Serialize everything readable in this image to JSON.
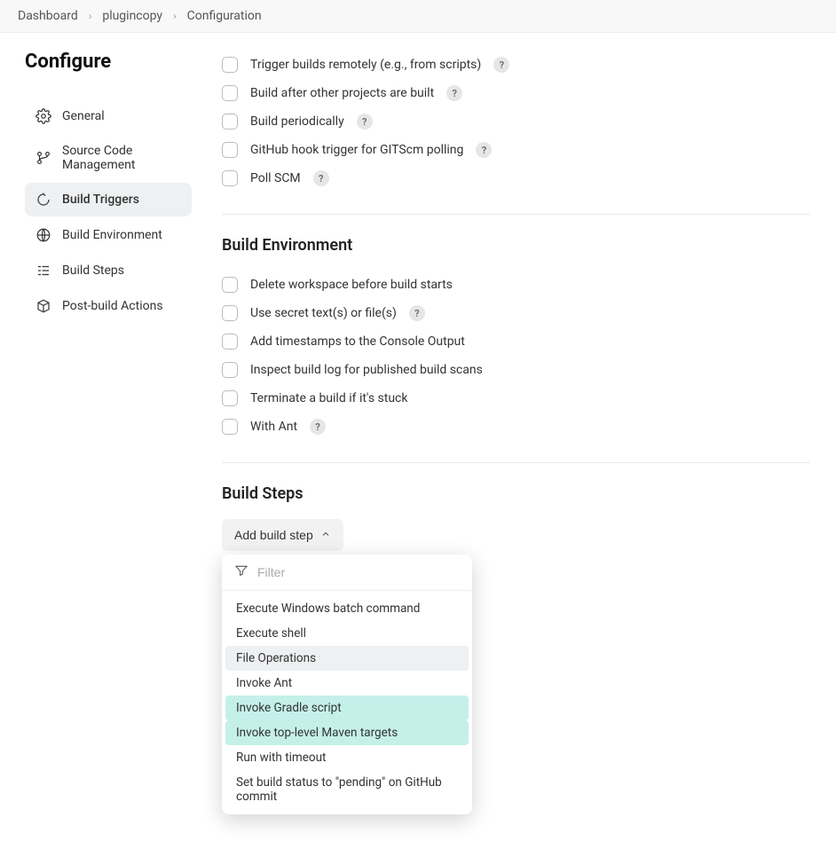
{
  "breadcrumb": {
    "items": [
      {
        "label": "Dashboard"
      },
      {
        "label": "plugincopy"
      },
      {
        "label": "Configuration"
      }
    ]
  },
  "page_title": "Configure",
  "sidebar": {
    "items": [
      {
        "label": "General",
        "icon": "gear-icon",
        "active": false
      },
      {
        "label": "Source Code Management",
        "icon": "branch-icon",
        "active": false
      },
      {
        "label": "Build Triggers",
        "icon": "trigger-icon",
        "active": true
      },
      {
        "label": "Build Environment",
        "icon": "globe-icon",
        "active": false
      },
      {
        "label": "Build Steps",
        "icon": "steps-icon",
        "active": false
      },
      {
        "label": "Post-build Actions",
        "icon": "package-icon",
        "active": false
      }
    ]
  },
  "triggers": {
    "items": [
      {
        "label": "Trigger builds remotely (e.g., from scripts)",
        "help": true
      },
      {
        "label": "Build after other projects are built",
        "help": true
      },
      {
        "label": "Build periodically",
        "help": true
      },
      {
        "label": "GitHub hook trigger for GITScm polling",
        "help": true
      },
      {
        "label": "Poll SCM",
        "help": true
      }
    ]
  },
  "build_env": {
    "heading": "Build Environment",
    "items": [
      {
        "label": "Delete workspace before build starts",
        "help": false
      },
      {
        "label": "Use secret text(s) or file(s)",
        "help": true
      },
      {
        "label": "Add timestamps to the Console Output",
        "help": false
      },
      {
        "label": "Inspect build log for published build scans",
        "help": false
      },
      {
        "label": "Terminate a build if it's stuck",
        "help": false
      },
      {
        "label": "With Ant",
        "help": true
      }
    ]
  },
  "build_steps": {
    "heading": "Build Steps",
    "button_label": "Add build step",
    "filter_placeholder": "Filter",
    "options": [
      {
        "label": "Execute Windows batch command",
        "state": ""
      },
      {
        "label": "Execute shell",
        "state": ""
      },
      {
        "label": "File Operations",
        "state": "hover"
      },
      {
        "label": "Invoke Ant",
        "state": ""
      },
      {
        "label": "Invoke Gradle script",
        "state": "hl"
      },
      {
        "label": "Invoke top-level Maven targets",
        "state": "hl"
      },
      {
        "label": "Run with timeout",
        "state": ""
      },
      {
        "label": "Set build status to \"pending\" on GitHub commit",
        "state": ""
      }
    ]
  },
  "help_glyph": "?"
}
